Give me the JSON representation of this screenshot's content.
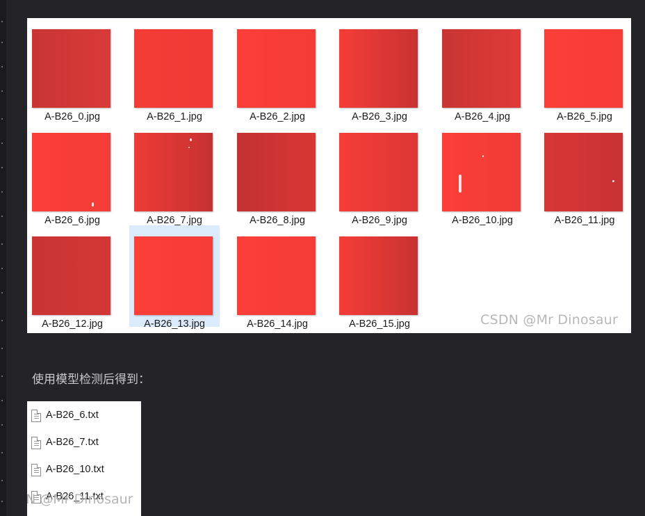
{
  "thumbnails": [
    {
      "name": "A-B26_0.jpg",
      "color_left": "#c93534",
      "color_right": "#d93a38"
    },
    {
      "name": "A-B26_1.jpg",
      "color_left": "#f43c36",
      "color_right": "#ef3a35"
    },
    {
      "name": "A-B26_2.jpg",
      "color_left": "#fb3e38",
      "color_right": "#f43b36"
    },
    {
      "name": "A-B26_3.jpg",
      "color_left": "#f53d37",
      "color_right": "#c93232"
    },
    {
      "name": "A-B26_4.jpg",
      "color_left": "#c83533",
      "color_right": "#e03a37"
    },
    {
      "name": "A-B26_5.jpg",
      "color_left": "#fb3e38",
      "color_right": "#f63c37"
    },
    {
      "name": "A-B26_6.jpg",
      "color_left": "#fb3e38",
      "color_right": "#f43c37"
    },
    {
      "name": "A-B26_7.jpg",
      "color_left": "#ee3b36",
      "color_right": "#c53231"
    },
    {
      "name": "A-B26_8.jpg",
      "color_left": "#c33232",
      "color_right": "#d73634"
    },
    {
      "name": "A-B26_9.jpg",
      "color_left": "#f53d37",
      "color_right": "#dd3735"
    },
    {
      "name": "A-B26_10.jpg",
      "color_left": "#fb3e38",
      "color_right": "#f03b36"
    },
    {
      "name": "A-B26_11.jpg",
      "color_left": "#d73634",
      "color_right": "#c93333"
    },
    {
      "name": "A-B26_12.jpg",
      "color_left": "#c93534",
      "color_right": "#d33634"
    },
    {
      "name": "A-B26_13.jpg",
      "color_left": "#fb3e38",
      "color_right": "#f63c37"
    },
    {
      "name": "A-B26_14.jpg",
      "color_left": "#fb3e38",
      "color_right": "#f53c37"
    },
    {
      "name": "A-B26_15.jpg",
      "color_left": "#f53d37",
      "color_right": "#c83232"
    }
  ],
  "selected_thumbnail": "A-B26_13.jpg",
  "watermark": "CSDN @Mr Dinosaur",
  "caption": "使用模型检测后得到：",
  "txt_files": [
    {
      "name": "A-B26_6.txt"
    },
    {
      "name": "A-B26_7.txt"
    },
    {
      "name": "A-B26_10.txt"
    },
    {
      "name": "A-B26_11.txt"
    }
  ],
  "watermark_partial": "N @Mr Dinosaur",
  "colors": {
    "background": "#232328",
    "panel": "#ffffff",
    "selection": "#dcebfc",
    "caption_text": "#c8c8cc"
  }
}
